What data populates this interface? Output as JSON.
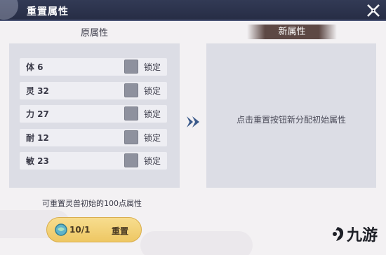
{
  "window": {
    "title": "重置属性"
  },
  "original": {
    "heading": "原属性",
    "lock_label": "锁定",
    "stats": [
      {
        "label": "体 6"
      },
      {
        "label": "灵 32"
      },
      {
        "label": "力 27"
      },
      {
        "label": "耐 12"
      },
      {
        "label": "敏 23"
      }
    ]
  },
  "new": {
    "heading": "新属性",
    "hint": "点击重置按钮新分配初始属性"
  },
  "footer": {
    "note": "可重置灵兽初始的100点属性",
    "reset_count": "10/1",
    "reset_label": "重置"
  },
  "colors": {
    "header": "#2b3149",
    "panel": "#dcdde5",
    "row": "#eeeef3",
    "checkbox": "#8e919e",
    "new_heading_bg": "#5d4844",
    "button": "#f2cf74",
    "arrow": "#3b5a8a"
  },
  "icons": [
    "close-icon",
    "arrow-right-icon",
    "gem-icon",
    "watermark-logo-icon"
  ]
}
